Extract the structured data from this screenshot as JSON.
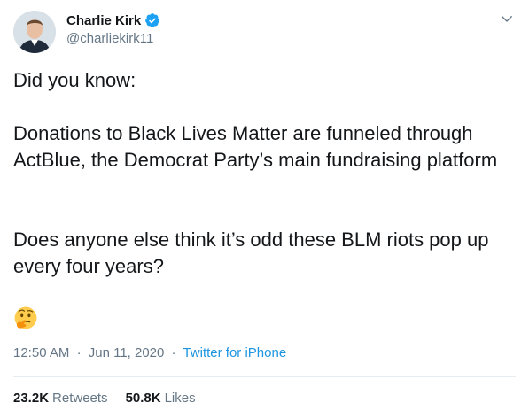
{
  "author": {
    "name": "Charlie Kirk",
    "handle": "@charliekirk11",
    "verified": true
  },
  "tweet": {
    "line1": "Did you know:",
    "para2": "Donations to Black Lives Matter are funneled through ActBlue, the Democrat Party’s main fundraising platform",
    "para3": "Does anyone else think it’s odd these BLM riots pop up every four years?",
    "emoji": "thinking-face"
  },
  "meta": {
    "time": "12:50 AM",
    "separator": "·",
    "date": "Jun 11, 2020",
    "source": "Twitter for iPhone"
  },
  "stats": {
    "retweets_count": "23.2K",
    "retweets_label": "Retweets",
    "likes_count": "50.8K",
    "likes_label": "Likes"
  },
  "colors": {
    "accent": "#1da1f2",
    "link": "#1b95e0",
    "muted": "#657786",
    "text": "#14171a"
  }
}
